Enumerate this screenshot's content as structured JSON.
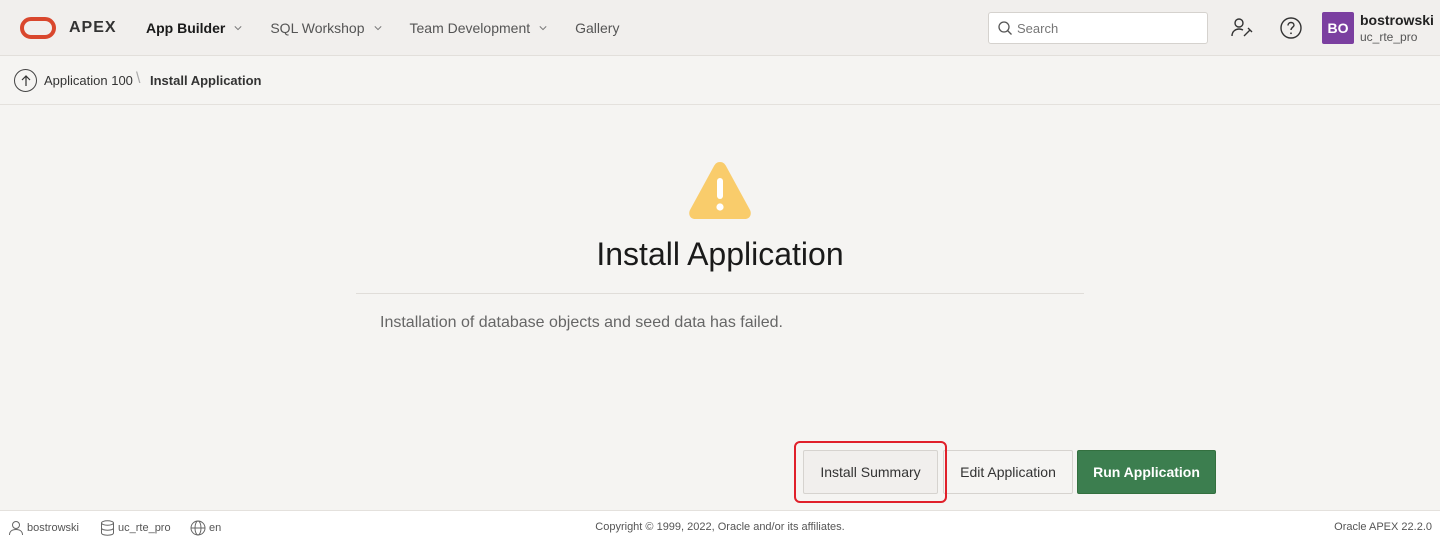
{
  "header": {
    "brand": "APEX",
    "nav": [
      {
        "label": "App Builder",
        "active": true,
        "has_menu": true
      },
      {
        "label": "SQL Workshop",
        "active": false,
        "has_menu": true
      },
      {
        "label": "Team Development",
        "active": false,
        "has_menu": true
      },
      {
        "label": "Gallery",
        "active": false,
        "has_menu": false
      }
    ],
    "search_placeholder": "Search",
    "user": {
      "initials": "BO",
      "name": "bostrowski",
      "workspace": "uc_rte_pro"
    },
    "avatar_color": "#7b3fa0",
    "logo_color": "#d9472d"
  },
  "breadcrumb": {
    "parent": "Application 100",
    "current": "Install Application"
  },
  "main": {
    "icon": "warning-triangle-icon",
    "icon_color": "#f9cc6b",
    "title": "Install Application",
    "message": "Installation of database objects and seed data has failed.",
    "buttons": {
      "summary": "Install Summary",
      "edit": "Edit Application",
      "run": "Run Application"
    },
    "run_button_color": "#3c7e4f",
    "highlighted_button": "Install Summary"
  },
  "footer": {
    "user": "bostrowski",
    "workspace": "uc_rte_pro",
    "language": "en",
    "copyright": "Copyright © 1999, 2022, Oracle and/or its affiliates.",
    "version": "Oracle APEX 22.2.0"
  }
}
